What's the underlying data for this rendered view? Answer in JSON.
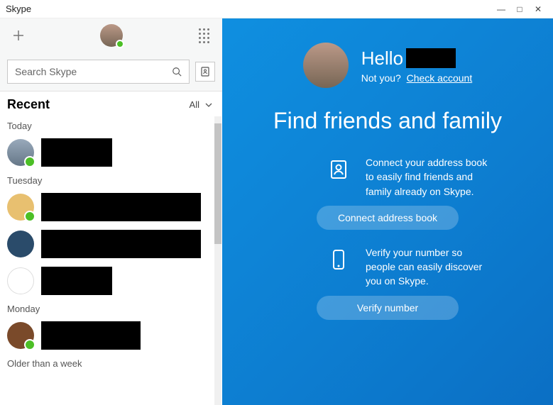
{
  "titlebar": {
    "app_name": "Skype"
  },
  "sidebar": {
    "search_placeholder": "Search Skype",
    "recent_title": "Recent",
    "filter_label": "All",
    "groups": [
      {
        "label": "Today"
      },
      {
        "label": "Tuesday"
      },
      {
        "label": "Monday"
      },
      {
        "label": "Older than a week"
      }
    ]
  },
  "main": {
    "greeting": "Hello",
    "not_you_text": "Not you?",
    "check_account": "Check account",
    "headline": "Find friends and family",
    "address_step_text": "Connect your address book to easily find friends and family already on Skype.",
    "address_cta": "Connect address book",
    "verify_step_text": "Verify your number so people can easily discover you on Skype.",
    "verify_cta": "Verify number"
  }
}
